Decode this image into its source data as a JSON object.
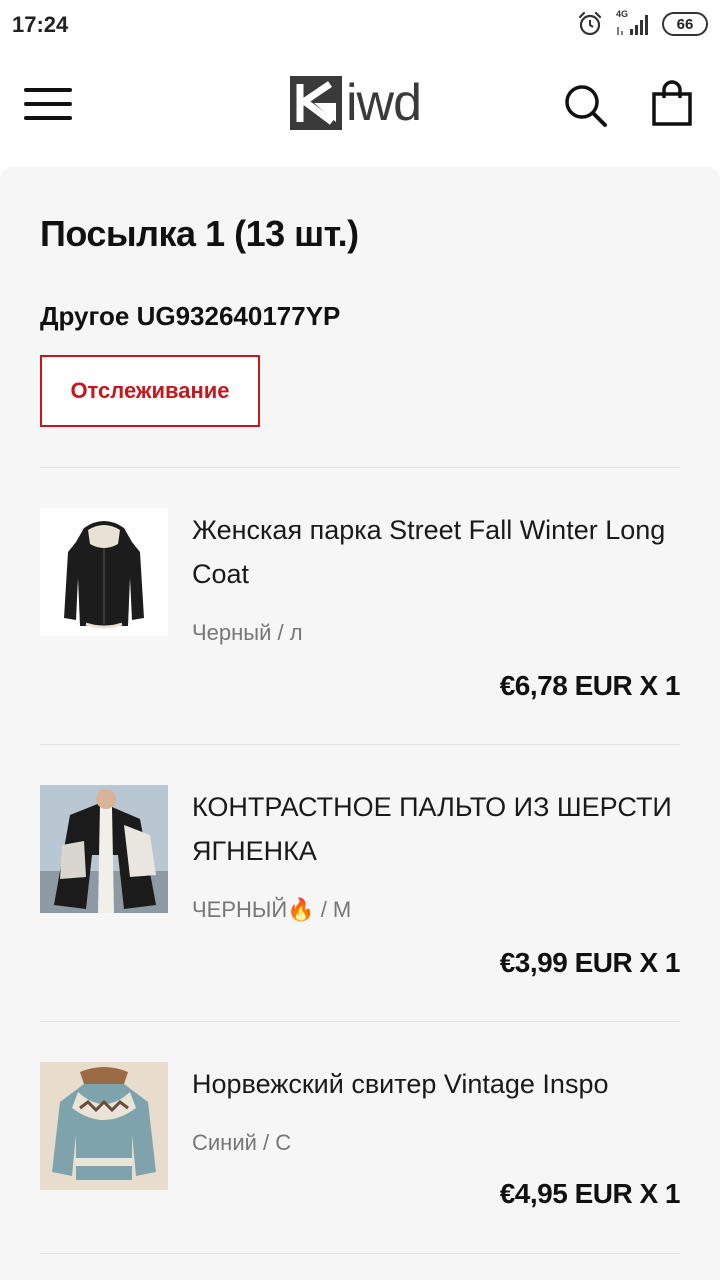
{
  "status_bar": {
    "time": "17:24",
    "network": "4G",
    "battery": "66",
    "icons": [
      "alarm-icon",
      "signal-icon",
      "battery-icon"
    ]
  },
  "header": {
    "logo_text": "iwd",
    "icons": [
      "menu-icon",
      "search-icon",
      "bag-icon"
    ]
  },
  "parcel": {
    "title": "Посылка 1 (13 шт.)",
    "tracking_line": "Другое UG932640177YP",
    "track_button_label": "Отслеживание"
  },
  "items": [
    {
      "name": "Женская парка Street Fall Winter Long Coat",
      "variant": "Черный / л",
      "price": "€6,78 EUR X 1"
    },
    {
      "name": "КОНТРАСТНОЕ ПАЛЬТО ИЗ ШЕРСТИ ЯГНЕНКА",
      "variant": "ЧЕРНЫЙ🔥 / M",
      "price": "€3,99 EUR X 1"
    },
    {
      "name": "Норвежский свитер Vintage Inspo",
      "variant": "Синий / С",
      "price": "€4,95 EUR X 1"
    }
  ],
  "colors": {
    "accent": "#c8161d",
    "panel_bg": "#f6f6f6",
    "text": "#111111",
    "muted": "#777777"
  }
}
